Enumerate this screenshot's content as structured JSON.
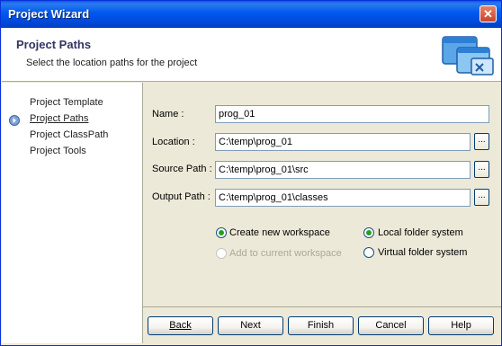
{
  "window": {
    "title": "Project Wizard",
    "close_glyph": "✕"
  },
  "header": {
    "title": "Project Paths",
    "subtitle": "Select the location paths for the project",
    "icon": "windows-icon"
  },
  "nav": {
    "items": [
      {
        "label": "Project Template",
        "active": false
      },
      {
        "label": "Project Paths",
        "active": true
      },
      {
        "label": "Project ClassPath",
        "active": false
      },
      {
        "label": "Project Tools",
        "active": false
      }
    ]
  },
  "form": {
    "name": {
      "label": "Name :",
      "value": "prog_01"
    },
    "location": {
      "label": "Location :",
      "value": "C:\\temp\\prog_01",
      "browse": "..."
    },
    "source": {
      "label": "Source Path :",
      "value": "C:\\temp\\prog_01\\src",
      "browse": "..."
    },
    "output": {
      "label": "Output Path :",
      "value": "C:\\temp\\prog_01\\classes",
      "browse": "..."
    }
  },
  "workspace": {
    "create": {
      "label": "Create new workspace",
      "checked": true,
      "enabled": true
    },
    "add": {
      "label": "Add to current workspace",
      "checked": false,
      "enabled": false
    }
  },
  "folder": {
    "local": {
      "label": "Local folder system",
      "checked": true
    },
    "virtual": {
      "label": "Virtual folder system",
      "checked": false
    }
  },
  "buttons": {
    "back": "Back",
    "next": "Next",
    "finish": "Finish",
    "cancel": "Cancel",
    "help": "Help"
  },
  "colors": {
    "accent": "#0058ee",
    "radio_dot": "#21a121"
  }
}
